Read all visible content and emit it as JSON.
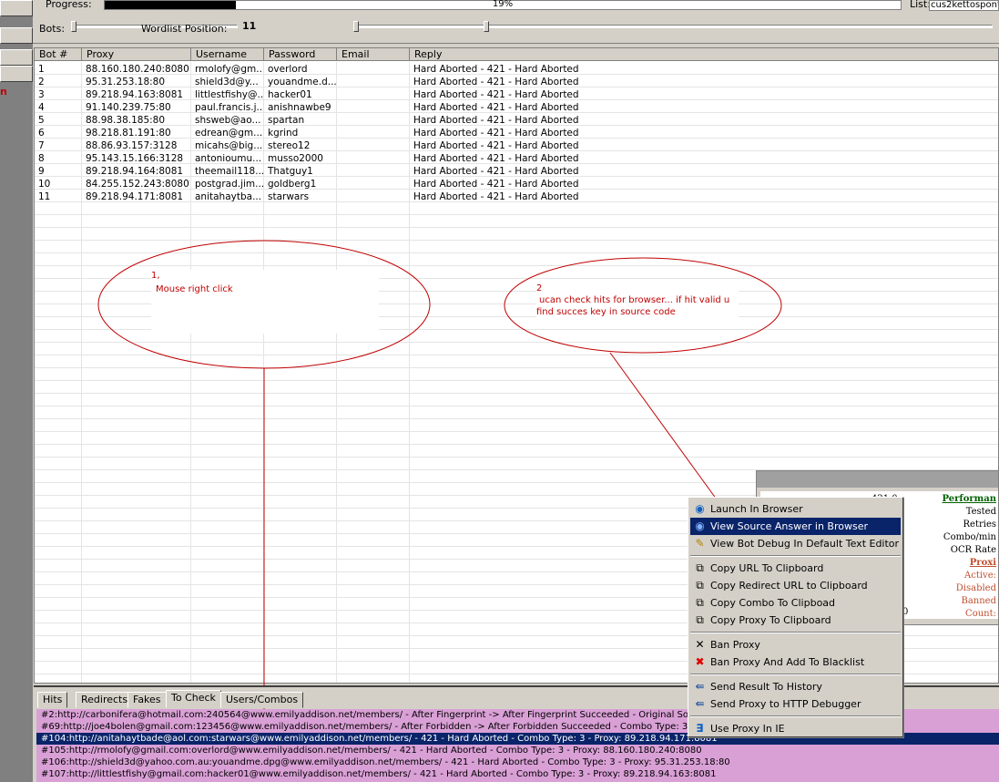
{
  "header": {
    "progress_label": "Progress:",
    "progress_percent": 19,
    "progress_text": "19%",
    "list_label": "List:",
    "list_value": "cus2kettospont",
    "bots_label": "Bots:",
    "bots_value": "11",
    "wordlist_label": "Wordlist Position:"
  },
  "left": {
    "red_text": "n"
  },
  "grid": {
    "columns": [
      "Bot #",
      "Proxy",
      "Username",
      "Password",
      "Email",
      "Reply"
    ],
    "rows": [
      [
        "1",
        "88.160.180.240:8080",
        "rmolofy@gm...",
        "overlord",
        "",
        "Hard Aborted - 421 - Hard Aborted"
      ],
      [
        "2",
        "95.31.253.18:80",
        "shield3d@y...",
        "youandme.d...",
        "",
        "Hard Aborted - 421 - Hard Aborted"
      ],
      [
        "3",
        "89.218.94.163:8081",
        "littlestfishy@...",
        "hacker01",
        "",
        "Hard Aborted - 421 - Hard Aborted"
      ],
      [
        "4",
        "91.140.239.75:80",
        "paul.francis.j...",
        "anishnawbe9",
        "",
        "Hard Aborted - 421 - Hard Aborted"
      ],
      [
        "5",
        "88.98.38.185:80",
        "shsweb@ao...",
        "spartan",
        "",
        "Hard Aborted - 421 - Hard Aborted"
      ],
      [
        "6",
        "98.218.81.191:80",
        "edrean@gm...",
        "kgrind",
        "",
        "Hard Aborted - 421 - Hard Aborted"
      ],
      [
        "7",
        "88.86.93.157:3128",
        "micahs@big...",
        "stereo12",
        "",
        "Hard Aborted - 421 - Hard Aborted"
      ],
      [
        "8",
        "95.143.15.166:3128",
        "antonioumu...",
        "musso2000",
        "",
        "Hard Aborted - 421 - Hard Aborted"
      ],
      [
        "9",
        "89.218.94.164:8081",
        "theemail118...",
        "Thatguy1",
        "",
        "Hard Aborted - 421 - Hard Aborted"
      ],
      [
        "10",
        "84.255.152.243:8080",
        "postgrad.jim...",
        "goldberg1",
        "",
        "Hard Aborted - 421 - Hard Aborted"
      ],
      [
        "11",
        "89.218.94.171:8081",
        "anitahaytba...",
        "starwars",
        "",
        "Hard Aborted - 421 - Hard Aborted"
      ]
    ]
  },
  "annotations": {
    "note1_line1": "1,",
    "note1_line2": "Mouse right click",
    "note2_line1": "2",
    "note2_line2": "ucan check hits for browser... if hit valid u",
    "note2_line3": "find succes key in source code"
  },
  "tabs": [
    "Hits",
    "Redirects",
    "Fakes",
    "To Check",
    "Users/Combos"
  ],
  "active_tab": "To Check",
  "log": [
    "#2:http://carbonifera@hotmail.com:240564@www.emilyaddison.net/members/ - After Fingerprint -> After Fingerprint Succeeded - Original Source Leng",
    "#69:http://joe4bolen@gmail.com:123456@www.emilyaddison.net/members/ - After Forbidden -> After Forbidden Succeeded - Combo Type: 3 - Proxy:",
    "#104:http://anitahaytbade@aol.com:starwars@www.emilyaddison.net/members/ - 421 - Hard Aborted - Combo Type: 3 - Proxy: 89.218.94.171:8081",
    "#105:http://rmolofy@gmail.com:overlord@www.emilyaddison.net/members/ - 421 - Hard Aborted - Combo Type: 3 - Proxy: 88.160.180.240:8080",
    "#106:http://shield3d@yahoo.com.au:youandme.dpg@www.emilyaddison.net/members/ - 421 - Hard Aborted - Combo Type: 3 - Proxy: 95.31.253.18:80",
    "#107:http://littlestfishy@gmail.com:hacker01@www.emilyaddison.net/members/ - 421 - Hard Aborted - Combo Type: 3 - Proxy: 89.218.94.163:8081"
  ],
  "perf": {
    "title": "Performan",
    "tested": "Tested",
    "retries": "Retries",
    "combo_min": "Combo/min",
    "ocr_rate": "OCR Rate",
    "proxies": "Proxi",
    "active": "Active:",
    "disabled": "Disabled",
    "banned": "Banned",
    "count": "Count:",
    "value_421": "421 0",
    "value_0": "0"
  },
  "context_menu": [
    {
      "label": "Launch In Browser",
      "icon": "ie-globe-icon"
    },
    {
      "label": "View Source Answer in Browser",
      "icon": "ie-globe-icon",
      "highlighted": true
    },
    {
      "label": "View Bot Debug In Default Text Editor",
      "icon": "edit-pencil-icon"
    },
    {
      "label": "Copy URL To Clipboard",
      "icon": "clipboard-icon"
    },
    {
      "label": "Copy Redirect URL to Clipboard",
      "icon": "clipboard-icon"
    },
    {
      "label": "Copy Combo To Clipboad",
      "icon": "clipboard-icon"
    },
    {
      "label": "Copy Proxy To Clipboard",
      "icon": "clipboard-icon"
    },
    {
      "label": "Ban Proxy",
      "icon": "x-black-icon"
    },
    {
      "label": "Ban Proxy And Add To Blacklist",
      "icon": "x-red-icon"
    },
    {
      "label": "Send Result To History",
      "icon": "arrow-left-icon"
    },
    {
      "label": "Send Proxy to HTTP Debugger",
      "icon": "arrow-left-icon"
    },
    {
      "label": "Use Proxy In IE",
      "icon": "ie-e-icon"
    }
  ],
  "colors": {
    "selection": "#0a246a",
    "annotation": "#c00000",
    "log_bg": "#d9a0d6"
  }
}
